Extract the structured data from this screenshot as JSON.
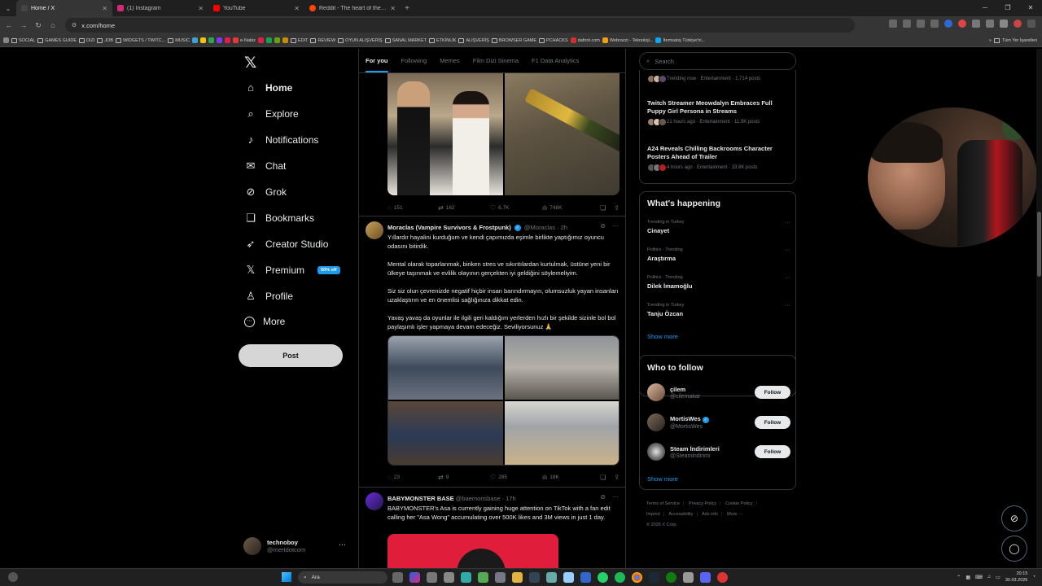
{
  "browser": {
    "tabs": [
      {
        "label": "Home / X",
        "color": "#444444",
        "active": true
      },
      {
        "label": "(1) Instagram",
        "color": "#d62976",
        "active": false
      },
      {
        "label": "YouTube",
        "color": "#ff0000",
        "active": false
      },
      {
        "label": "Reddit - The heart of the intern",
        "color": "#ff4500",
        "active": false
      }
    ],
    "url": "x.com/home",
    "bookmarks": [
      "SOCIAL",
      "GAMES GUIDE",
      "DIZI",
      "JOB",
      "WIDGETS / TWITC...",
      "MUSIC",
      "e-Nabiz",
      "EDIT",
      "REVIEW",
      "OYUN ALIŞVERİŞ",
      "SANAL MARKET",
      "ETKİNLİK",
      "ALIŞVERİŞ",
      "BROWSER GAME",
      "PCHACKS",
      "dafont.com",
      "Webrazzi - Teknoloji...",
      "İtemsatış Türkiye'ni..."
    ],
    "bookmarks_right": "Tüm Yer İşaretleri"
  },
  "nav": {
    "items": [
      {
        "label": "Home",
        "icon": "home-icon",
        "glyph": "⌂"
      },
      {
        "label": "Explore",
        "icon": "search-icon",
        "glyph": "⌕"
      },
      {
        "label": "Notifications",
        "icon": "bell-icon",
        "glyph": "🔔"
      },
      {
        "label": "Chat",
        "icon": "mail-icon",
        "glyph": "✉"
      },
      {
        "label": "Grok",
        "icon": "grok-icon",
        "glyph": "⊘"
      },
      {
        "label": "Bookmarks",
        "icon": "bookmark-icon",
        "glyph": "❏"
      },
      {
        "label": "Creator Studio",
        "icon": "rocket-icon",
        "glyph": "➶"
      },
      {
        "label": "Premium",
        "icon": "x-logo-icon",
        "glyph": "𝕏"
      },
      {
        "label": "Profile",
        "icon": "person-icon",
        "glyph": "♙"
      },
      {
        "label": "More",
        "icon": "more-circle-icon",
        "glyph": "⋯"
      }
    ],
    "premium_badge": "50% off",
    "post_label": "Post",
    "account": {
      "name": "technoboy",
      "handle": "@mertdotcom"
    }
  },
  "feed": {
    "tabs": [
      "For you",
      "Following",
      "Memes",
      "Film Dizi Sinema",
      "F1 Data Analytics"
    ],
    "top_actions": {
      "replies": "151",
      "reposts": "162",
      "likes": "6,7K",
      "views": "748K"
    },
    "tweet2": {
      "name": "Moraclas (Vampire Survivors & Frostpunk)",
      "handle": "@Moraclas · 2h",
      "paragraphs": [
        "Yıllardır hayalini kurduğum ve kendi çapımızda eşimle birlikte yaptığımız oyuncu odasını bitirdik.",
        "Mental olarak toparlanmak, biriken stres ve sıkıntılardan kurtulmak, üstüne yeni bir ülkeye taşınmak ve evlilik olayının gerçekten iyi geldiğini söylemeliyim.",
        "Siz siz olun çevrenizde negatif hiçbir insan barındırmayın, olumsuzluk yayan insanları uzaklaştırın ve en önemlisi sağlığınıza dikkat edin.",
        "Yavaş yavaş da oyunlar ile ilgili geri kaldığım yerlerden hızlı bir şekilde sizinle bol bol paylaşımlı işler yapmaya devam edeceğiz. Seviliyorsunuz 🙏"
      ],
      "actions": {
        "replies": "23",
        "reposts": "9",
        "likes": "285",
        "views": "18K"
      }
    },
    "tweet3": {
      "name": "BABYMONSTER BASE",
      "handle": "@baemonsbase · 17h",
      "text": "BABYMONSTER's Asa is currently gaining huge attention on TikTok with a fan edit calling her \"Asa Wong\" accumulating over 500K likes and 3M views in just 1 day."
    }
  },
  "sidebar": {
    "search_placeholder": "Search",
    "news": [
      {
        "title": "",
        "meta": "Trending now · Entertainment · 1,714 posts"
      },
      {
        "title": "Twitch Streamer Meowdalyn Embraces Full Puppy Girl Persona in Streams",
        "meta": "21 hours ago · Entertainment · 11.5K posts"
      },
      {
        "title": "A24 Reveals Chilling Backrooms Character Posters Ahead of Trailer",
        "meta": "4 hours ago · Entertainment · 19.8K posts"
      }
    ],
    "whats_happening_title": "What's happening",
    "trends": [
      {
        "context": "Trending in Turkey",
        "title": "Cinayet"
      },
      {
        "context": "Politics · Trending",
        "title": "Araştırma"
      },
      {
        "context": "Politics · Trending",
        "title": "Dilek İmamoğlu"
      },
      {
        "context": "Trending in Turkey",
        "title": "Tanju Özcan"
      }
    ],
    "show_more": "Show more",
    "who_to_follow_title": "Who to follow",
    "follows": [
      {
        "name": "çilem",
        "handle": "@cilemakar",
        "verified": false
      },
      {
        "name": "MortisWes",
        "handle": "@MortisWes",
        "verified": true
      },
      {
        "name": "Steam İndirimleri",
        "handle": "@Steamindirimi",
        "verified": false
      }
    ],
    "follow_label": "Follow",
    "footer": [
      "Terms of Service",
      "Privacy Policy",
      "Cookie Policy",
      "Imprint",
      "Accessibility",
      "Ads info",
      "More ···",
      "© 2026 X Corp."
    ]
  },
  "taskbar": {
    "search_label": "Ara",
    "time": "20:15",
    "date": "30.03.2026"
  }
}
